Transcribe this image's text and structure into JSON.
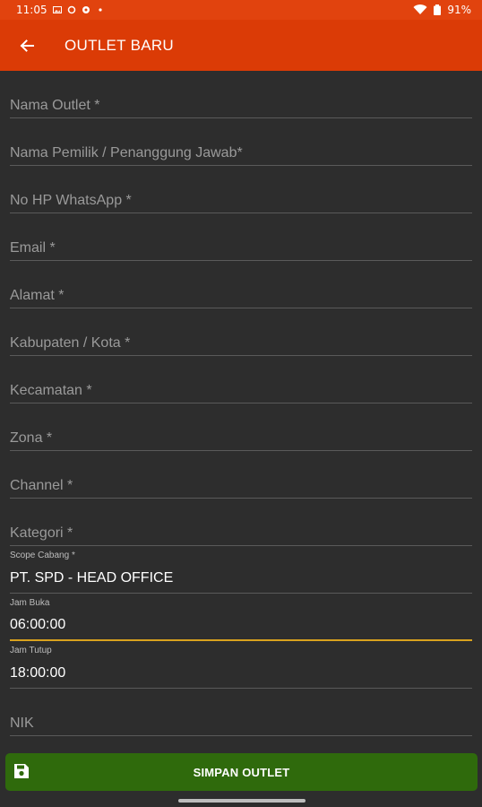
{
  "status_bar": {
    "time": "11:05",
    "battery": "91%"
  },
  "app_bar": {
    "title": "OUTLET BARU",
    "back_icon": "arrow-left-icon"
  },
  "form": {
    "fields": [
      {
        "placeholder": "Nama Outlet *"
      },
      {
        "placeholder": "Nama Pemilik / Penanggung Jawab*"
      },
      {
        "placeholder": "No HP WhatsApp *"
      },
      {
        "placeholder": "Email *"
      },
      {
        "placeholder": "Alamat *"
      },
      {
        "placeholder": "Kabupaten / Kota *"
      },
      {
        "placeholder": "Kecamatan *"
      },
      {
        "placeholder": "Zona *"
      },
      {
        "placeholder": "Channel *"
      },
      {
        "placeholder": "Kategori *"
      },
      {
        "label": "Scope Cabang *",
        "value": "PT. SPD - HEAD OFFICE"
      },
      {
        "label": "Jam Buka",
        "value": "06:00:00"
      },
      {
        "label": "Jam Tutup",
        "value": "18:00:00"
      },
      {
        "placeholder": "NIK"
      }
    ]
  },
  "save_button": {
    "label": "SIMPAN OUTLET",
    "icon": "save-icon"
  },
  "colors": {
    "app_bar": "#db3b06",
    "background": "#2d2d2d",
    "save_button": "#2f6a0c",
    "focus_underline": "#d9a21e"
  }
}
